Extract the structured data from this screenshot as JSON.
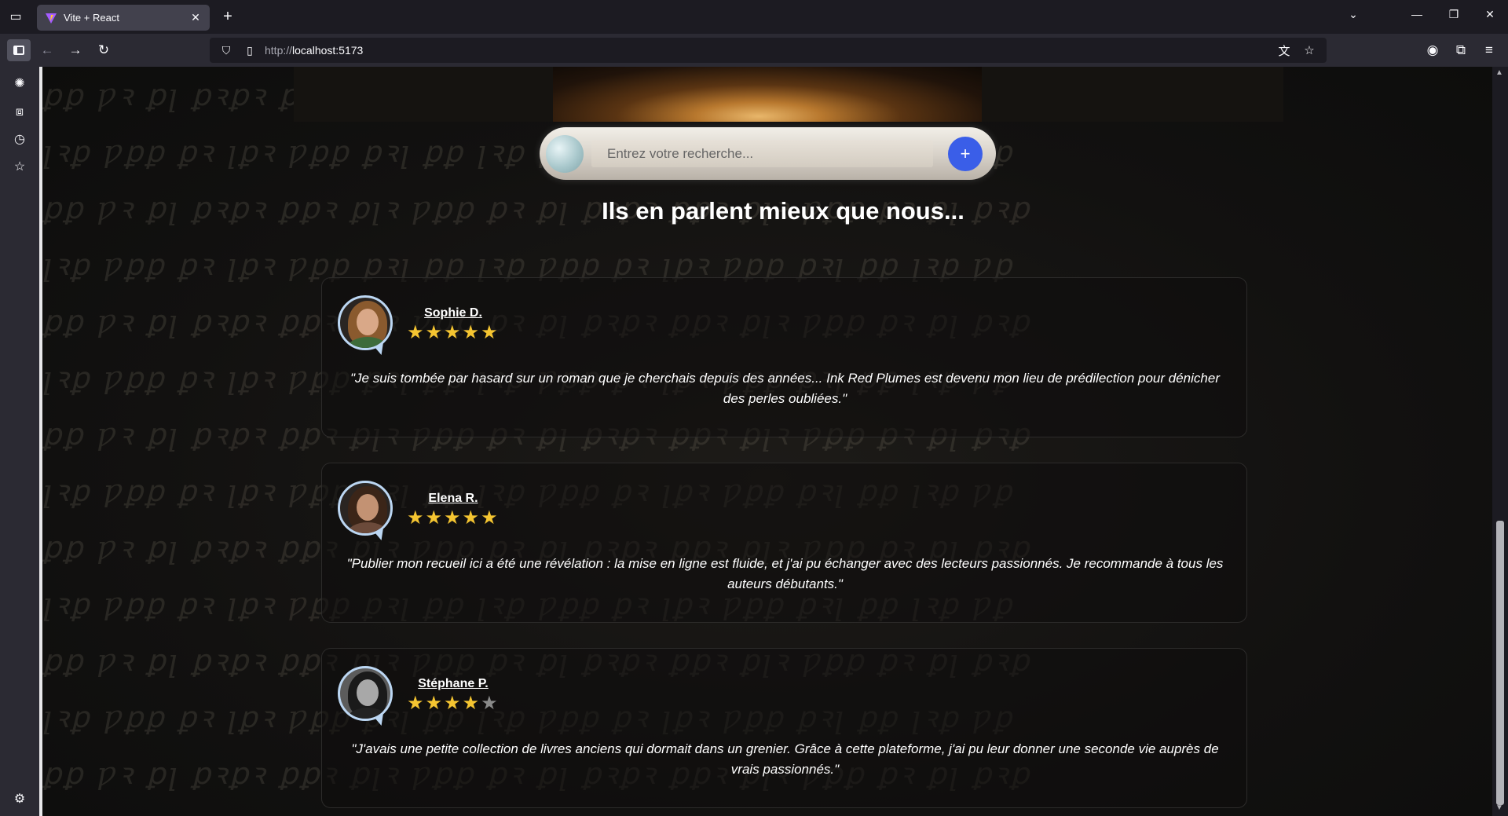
{
  "browser": {
    "tab_title": "Vite + React",
    "url_prefix": "http://",
    "url_host": "localhost:5173"
  },
  "search": {
    "placeholder": "Entrez votre recherche...",
    "submit_label": "+"
  },
  "section_title": "Ils en parlent mieux que nous...",
  "testimonials": [
    {
      "name": "Sophie D.",
      "rating": 5,
      "quote": "\"Je suis tombée par hasard sur un roman que je cherchais depuis des années... Ink Red Plumes est devenu mon lieu de prédilection pour dénicher des perles oubliées.\""
    },
    {
      "name": "Elena R.",
      "rating": 5,
      "quote": "\"Publier mon recueil ici a été une révélation : la mise en ligne est fluide, et j'ai pu échanger avec des lecteurs passionnés. Je recommande à tous les auteurs débutants.\""
    },
    {
      "name": "Stéphane P.",
      "rating": 4,
      "quote": "\"J'avais une petite collection de livres anciens qui dormait dans un grenier. Grâce à cette plateforme, j'ai pu leur donner une seconde vie auprès de vrais passionnés.\""
    }
  ],
  "colors": {
    "accent_button": "#3a5ee8",
    "star_on": "#f5c531",
    "star_off": "#8a8a8a",
    "avatar_border": "#bcd7f3"
  }
}
